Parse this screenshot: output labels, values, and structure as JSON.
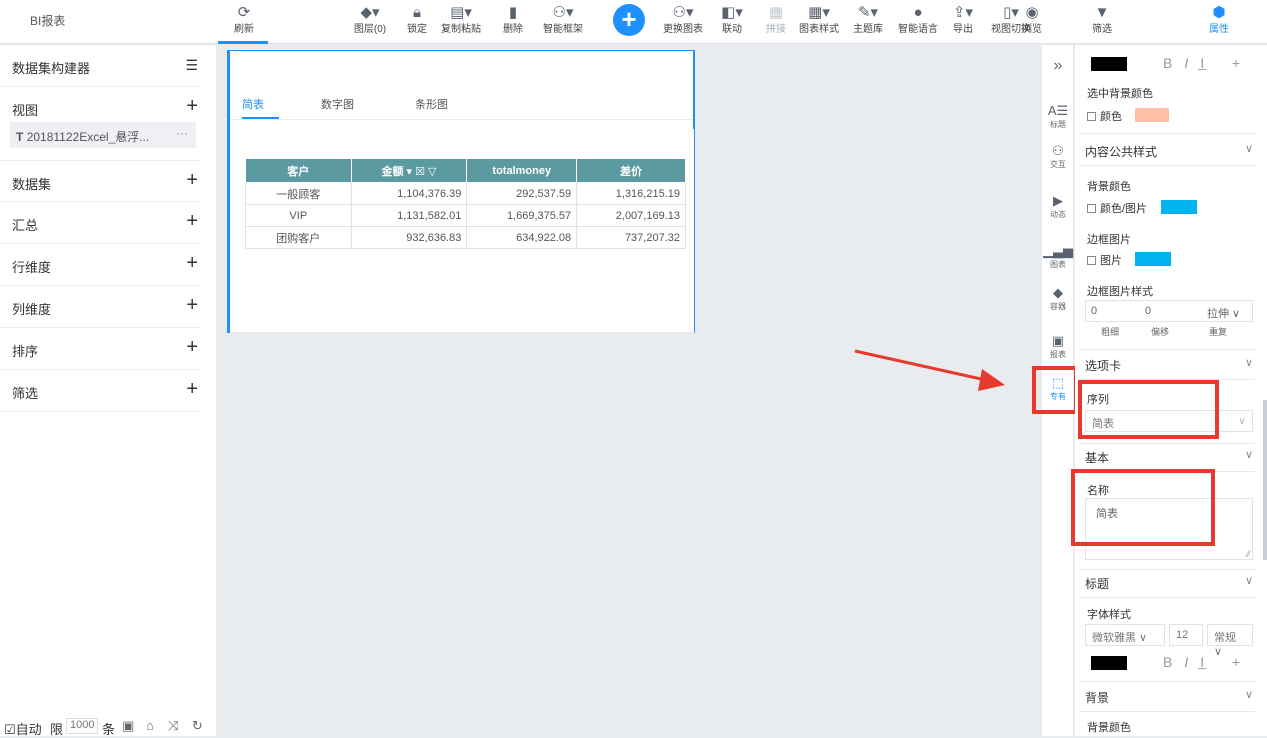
{
  "app": {
    "title": "BI报表"
  },
  "toolbar": {
    "refresh": "刷新",
    "layers": "图层(0)",
    "lock": "锁定",
    "copy_paste": "复制粘贴",
    "delete": "删除",
    "smart_frame": "智能框架",
    "change_chart": "更换图表",
    "link": "联动",
    "splice": "拼接",
    "chart_style": "图表样式",
    "theme": "主题库",
    "smart_voice": "智能语言",
    "export": "导出",
    "view_switch": "视图切换",
    "browse": "浏览",
    "filter": "筛选",
    "properties": "属性",
    "add_symbol": "+"
  },
  "left_panel": {
    "builder_title": "数据集构建器",
    "view_label": "视图",
    "view_item": "20181122Excel_悬浮...",
    "view_item_prefix": "T",
    "view_item_more": "···",
    "sections": [
      "数据集",
      "汇总",
      "行维度",
      "列维度",
      "排序",
      "筛选"
    ],
    "bottom_bar": {
      "auto_label": "自动",
      "limit_label": "限",
      "limit_value": "1000",
      "unit": "条"
    }
  },
  "card": {
    "tabs": [
      "简表",
      "数字图",
      "条形图"
    ],
    "active_tab": 0,
    "table": {
      "headers": [
        "客户",
        "金额 ▾ ☒ ▽",
        "totalmoney",
        "差价"
      ],
      "rows": [
        [
          "一般顾客",
          "1,104,376.39",
          "292,537.59",
          "1,316,215.19"
        ],
        [
          "VIP",
          "1,131,582.01",
          "1,669,375.57",
          "2,007,169.13"
        ],
        [
          "团购客户",
          "932,636.83",
          "634,922.08",
          "737,207.32"
        ]
      ]
    }
  },
  "icon_column": {
    "collapse": "»",
    "title": "标题",
    "interact": "交互",
    "animate": "动态",
    "chart": "图表",
    "container": "容器",
    "report": "报表",
    "exclusive": "专有"
  },
  "props": {
    "selected_bg_color": "选中背景颜色",
    "color_label": "颜色",
    "content_style": "内容公共样式",
    "bg_color": "背景颜色",
    "color_image": "颜色/图片",
    "border_image": "边框图片",
    "image": "图片",
    "border_image_style": "边框图片样式",
    "thickness_value": "0",
    "offset_value": "0",
    "repeat_value": "拉伸",
    "thickness_label": "粗细",
    "offset_label": "偏移",
    "repeat_label": "重复",
    "tabs_section": "选项卡",
    "sequence_label": "序列",
    "sequence_value": "简表",
    "basic_section": "基本",
    "name_label": "名称",
    "name_value": "简表",
    "title_section": "标题",
    "font_style": "字体样式",
    "font_family_value": "微软雅黑",
    "font_size_value": "12",
    "font_weight_value": "常规",
    "bg_section": "背景",
    "bg_color2": "背景颜色"
  },
  "colors": {
    "accent": "#1e90ff",
    "header_teal": "#5a9aa0",
    "swatch_peach": "#ffc0a8",
    "swatch_cyan": "#00b2f0",
    "highlight_red": "#e8392e"
  }
}
